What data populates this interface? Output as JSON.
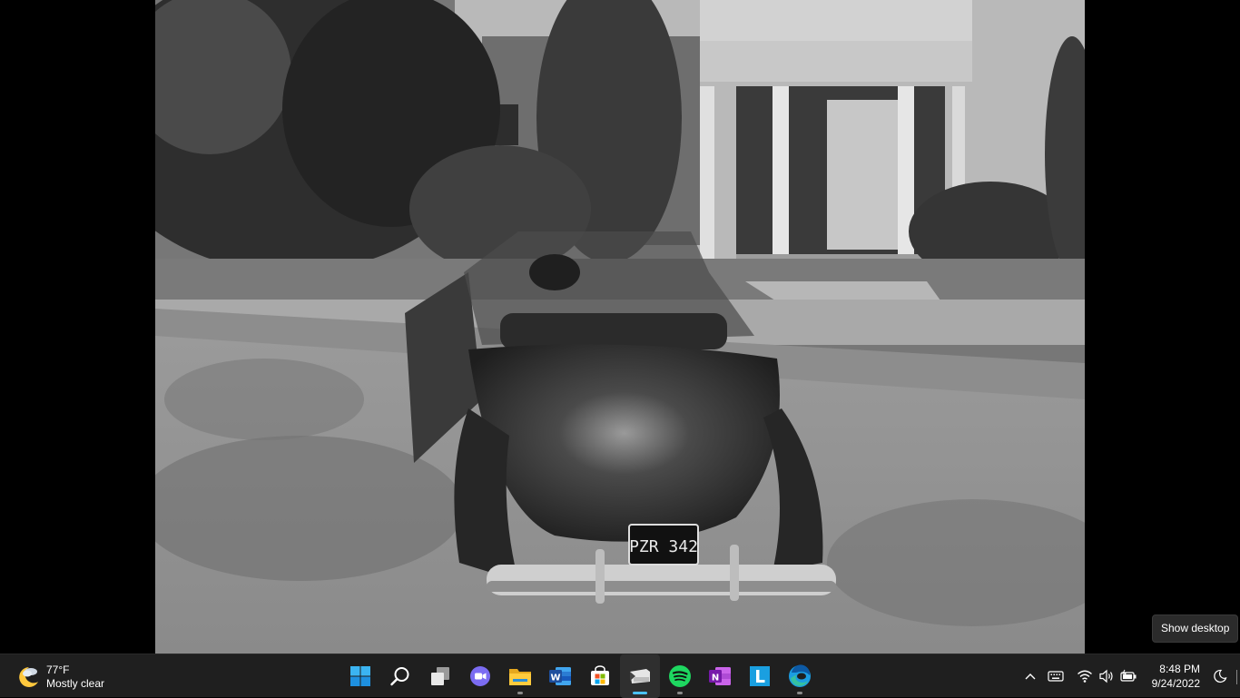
{
  "video": {
    "plate_text": "PZR 342"
  },
  "tooltip": {
    "text": "Show desktop"
  },
  "weather": {
    "temp": "77°F",
    "condition": "Mostly clear",
    "icon": "moon-cloud-icon"
  },
  "taskbar": {
    "apps": [
      {
        "name": "start",
        "icon": "windows-logo-icon"
      },
      {
        "name": "search",
        "icon": "search-icon"
      },
      {
        "name": "task-view",
        "icon": "task-view-icon"
      },
      {
        "name": "teams-chat",
        "icon": "video-chat-icon"
      },
      {
        "name": "file-explorer",
        "icon": "folder-icon",
        "running": true
      },
      {
        "name": "word",
        "icon": "word-icon"
      },
      {
        "name": "microsoft-store",
        "icon": "store-bag-icon"
      },
      {
        "name": "media-player",
        "icon": "media-player-icon",
        "running": true,
        "active": true
      },
      {
        "name": "spotify",
        "icon": "spotify-icon",
        "running": true
      },
      {
        "name": "onenote",
        "icon": "onenote-icon"
      },
      {
        "name": "app-l",
        "icon": "l-letter-icon"
      },
      {
        "name": "edge",
        "icon": "edge-icon",
        "running": true
      }
    ],
    "colors": {
      "accent": "#4cc2ff",
      "background": "#1f1f1f"
    }
  },
  "tray": {
    "icons": [
      "chevron-up-icon",
      "keyboard-icon",
      "wifi-icon",
      "speaker-icon",
      "battery-icon"
    ]
  },
  "clock": {
    "time": "8:48 PM",
    "date": "9/24/2022"
  },
  "focus": {
    "icon": "moon-icon"
  }
}
